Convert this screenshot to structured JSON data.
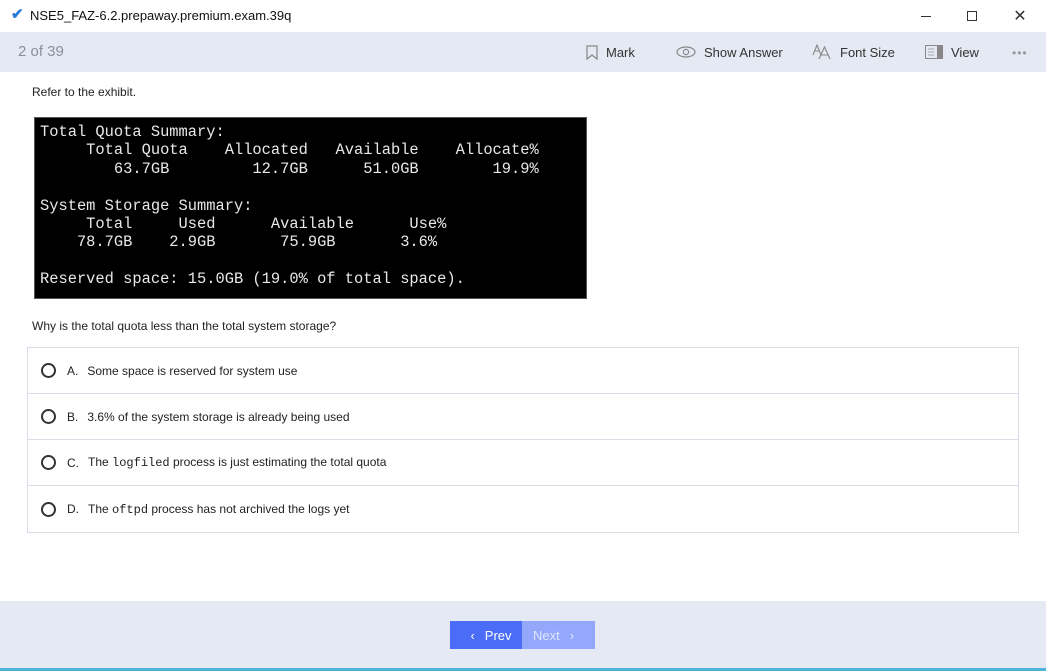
{
  "window": {
    "title": "NSE5_FAZ-6.2.prepaway.premium.exam.39q",
    "app_icon": "checkmark-icon",
    "controls": {
      "minimize": "minimize-icon",
      "maximize": "maximize-icon",
      "close": "close-icon",
      "close_glyph": "✕"
    }
  },
  "toolbar": {
    "counter": "2 of 39",
    "mark_label": "Mark",
    "show_answer_label": "Show Answer",
    "font_size_label": "Font Size",
    "view_label": "View",
    "more_glyph": "•••"
  },
  "question": {
    "intro": "Refer to the exhibit.",
    "exhibit_lines": [
      "Total Quota Summary:",
      "     Total Quota    Allocated   Available    Allocate%",
      "        63.7GB         12.7GB      51.0GB        19.9%",
      "",
      "System Storage Summary:",
      "     Total     Used      Available      Use%",
      "    78.7GB    2.9GB       75.9GB       3.6%",
      "",
      "Reserved space: 15.0GB (19.0% of total space)."
    ],
    "text": "Why is the total quota less than the total system storage?",
    "options": [
      {
        "letter": "A.",
        "pre": "Some space is reserved for system use",
        "code": "",
        "post": ""
      },
      {
        "letter": "B.",
        "pre": "3.6% of the system storage is already being used",
        "code": "",
        "post": ""
      },
      {
        "letter": "C.",
        "pre": "The ",
        "code": "logfiled",
        "post": " process is just estimating the total quota"
      },
      {
        "letter": "D.",
        "pre": "The ",
        "code": "oftpd",
        "post": " process has not archived the logs yet"
      }
    ]
  },
  "footer": {
    "prev_label": "Prev",
    "next_label": "Next",
    "prev_glyph": "‹",
    "next_glyph": "›"
  }
}
